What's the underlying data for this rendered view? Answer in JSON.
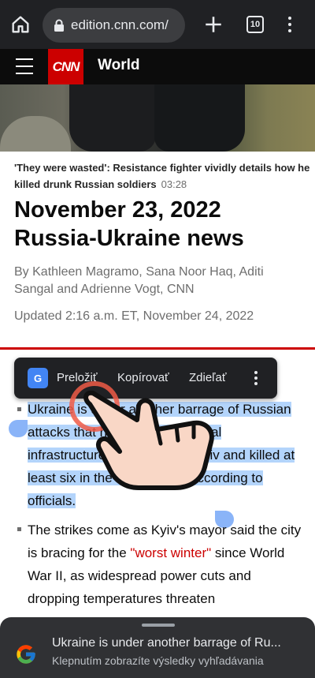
{
  "browser": {
    "url": "edition.cnn.com/",
    "tab_count": "10",
    "colors": {
      "bar": "#202124",
      "pill": "#3c3d40"
    }
  },
  "site": {
    "logo_text": "CNN",
    "section": "World",
    "colors": {
      "brand_red": "#cc0000",
      "header_bg": "#0c0c0c"
    }
  },
  "article": {
    "video_caption": "'They were wasted': Resistance fighter vividly details how he killed drunk Russian soldiers",
    "video_duration": "03:28",
    "headline_line1": "November 23, 2022",
    "headline_line2": "Russia-Ukraine news",
    "byline": "By Kathleen Magramo, Sana Noor Haq, Aditi Sangal and Adrienne Vogt, CNN",
    "updated": "Updated 2:16 a.m. ET, November 24, 2022",
    "bullet1_visible_start": "Ukrain",
    "bullet1_visible_a": "e is under another barrage of Russian attacks that have affected critical infrastructure as far west as Lviv and killed at least six in the Kyiv region, according to officials.",
    "bullet2_pre": "The strikes come as Kyiv's mayor said the city is bracing for the ",
    "bullet2_link": "\"worst winter\"",
    "bullet2_post": " since World War II, as widespread power cuts and dropping temperatures threaten"
  },
  "selection_toolbar": {
    "translate": "Preložiť",
    "copy": "Kopírovať",
    "share": "Zdieľať",
    "icon_name": "google-translate-icon"
  },
  "google_sheet": {
    "title": "Ukraine is under another barrage of Ru...",
    "subtitle": "Klepnutím zobrazíte výsledky vyhľadávania"
  }
}
